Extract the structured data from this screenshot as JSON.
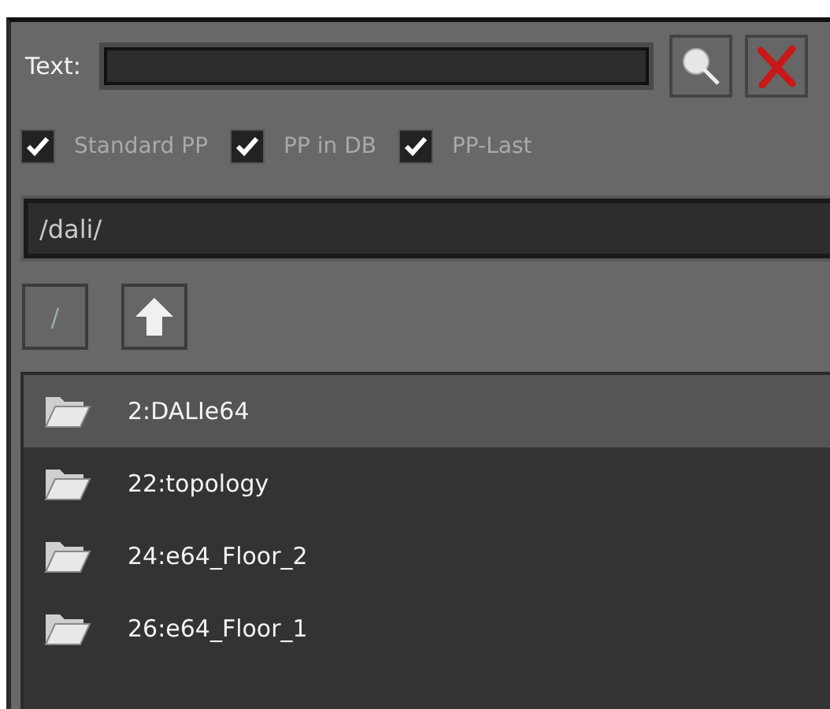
{
  "search": {
    "label": "Text:"
  },
  "filters": [
    {
      "label": "Standard PP",
      "checked": true
    },
    {
      "label": "PP in DB",
      "checked": true
    },
    {
      "label": "PP-Last",
      "checked": true
    }
  ],
  "path": {
    "value": "/dali/"
  },
  "root_button": {
    "label": "/"
  },
  "items": [
    {
      "label": "2:DALIe64",
      "selected": true
    },
    {
      "label": "22:topology",
      "selected": false
    },
    {
      "label": "24:e64_Floor_2",
      "selected": false
    },
    {
      "label": "26:e64_Floor_1",
      "selected": false
    }
  ]
}
